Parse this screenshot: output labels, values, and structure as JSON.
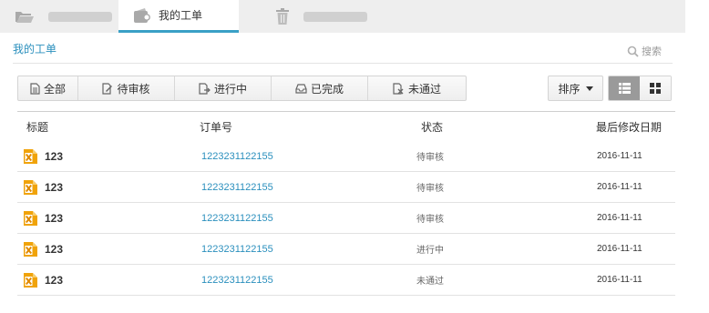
{
  "top_tabs": [
    {
      "label": "",
      "icon": "folder-open-icon"
    },
    {
      "label": "我的工单",
      "icon": "wallet-icon"
    },
    {
      "label": "",
      "icon": "trash-icon"
    }
  ],
  "colors": {
    "accent": "#3aa0c6",
    "link": "#2a8fbd",
    "file_icon": "#f0a30a"
  },
  "page_title": "我的工单",
  "search_label": "搜索",
  "filters": [
    {
      "label": "全部",
      "icon": "document-icon"
    },
    {
      "label": "待审核",
      "icon": "edit-document-icon"
    },
    {
      "label": "进行中",
      "icon": "export-document-icon"
    },
    {
      "label": "已完成",
      "icon": "inbox-icon"
    },
    {
      "label": "未通过",
      "icon": "cancel-document-icon"
    }
  ],
  "sort_label": "排序",
  "columns": {
    "title": "标题",
    "order": "订单号",
    "status": "状态",
    "date": "最后修改日期"
  },
  "rows": [
    {
      "title": "123",
      "order": "1223231122155",
      "status": "待审核",
      "date": "2016-11-11"
    },
    {
      "title": "123",
      "order": "1223231122155",
      "status": "待审核",
      "date": "2016-11-11"
    },
    {
      "title": "123",
      "order": "1223231122155",
      "status": "待审核",
      "date": "2016-11-11"
    },
    {
      "title": "123",
      "order": "1223231122155",
      "status": "进行中",
      "date": "2016-11-11"
    },
    {
      "title": "123",
      "order": "1223231122155",
      "status": "未通过",
      "date": "2016-11-11"
    }
  ]
}
